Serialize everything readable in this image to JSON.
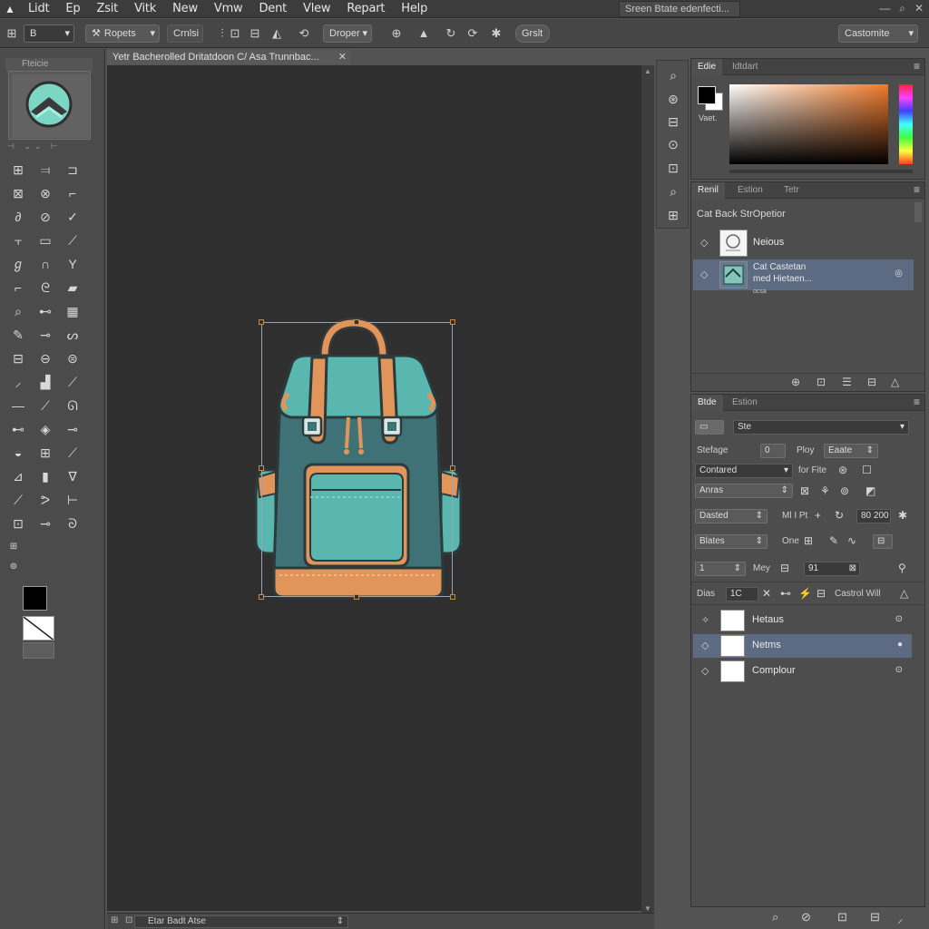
{
  "menubar": {
    "items": [
      "Lidt",
      "Ep",
      "Zsit",
      "Vitk",
      "New",
      "Vmw",
      "Dent",
      "Vlew",
      "Repart",
      "Help"
    ],
    "search_text": "Sreen Btate edenfecti...",
    "window_controls": [
      "—",
      "⌕",
      "✕"
    ]
  },
  "options": {
    "tool_preset": "B",
    "presets_label": "Ropets",
    "mode_label": "Crnlsi",
    "dropper_label": "Droper",
    "aux_button": "Grslt",
    "workspace": "Castomite"
  },
  "tools": {
    "navigator_label": "Fteicie"
  },
  "document": {
    "tab_title": "Yetr Bacherolled Dritatdoon C/ Asa Trunnbac...",
    "status_field": "Etar Badt Atse"
  },
  "color_panel": {
    "tabs": [
      "Edie",
      "Idtdart"
    ],
    "caption": "Vaet."
  },
  "paths_panel": {
    "tabs": [
      "Renil",
      "Estion",
      "Tetr"
    ],
    "header": "Cat Back StrOpetior",
    "items": [
      {
        "label": "Neious"
      },
      {
        "line1": "Cat Castetan",
        "line2": "med Hietaen...",
        "line3": "ocsa"
      }
    ]
  },
  "layers_panel": {
    "tabs": [
      "Btde",
      "Estion"
    ],
    "kind_field": "Ste",
    "strokage_label": "Stefage",
    "strokage_value": "0",
    "play_label": "Ploy",
    "play_value": "Eaate",
    "blend_select": "Contared",
    "for_fire_label": "for Fite",
    "anras_select": "Anras",
    "dasted_select": "Dasted",
    "mid_label": "Ml I Pt",
    "percent_value": "80 200",
    "blates_select": "Blates",
    "one_label": "One",
    "num_value": "1",
    "mey_label": "Mey",
    "mey_value": "91",
    "dias_label": "Dias",
    "dias_value": "1C",
    "control_label": "Castrol Will",
    "layers": [
      {
        "label": "Hetaus"
      },
      {
        "label": "Netms"
      },
      {
        "label": "Complour"
      }
    ]
  },
  "colors": {
    "accent": "#5c6a82",
    "teal": "#5ab7b0",
    "slate": "#3f7276",
    "orange": "#e2955a"
  }
}
